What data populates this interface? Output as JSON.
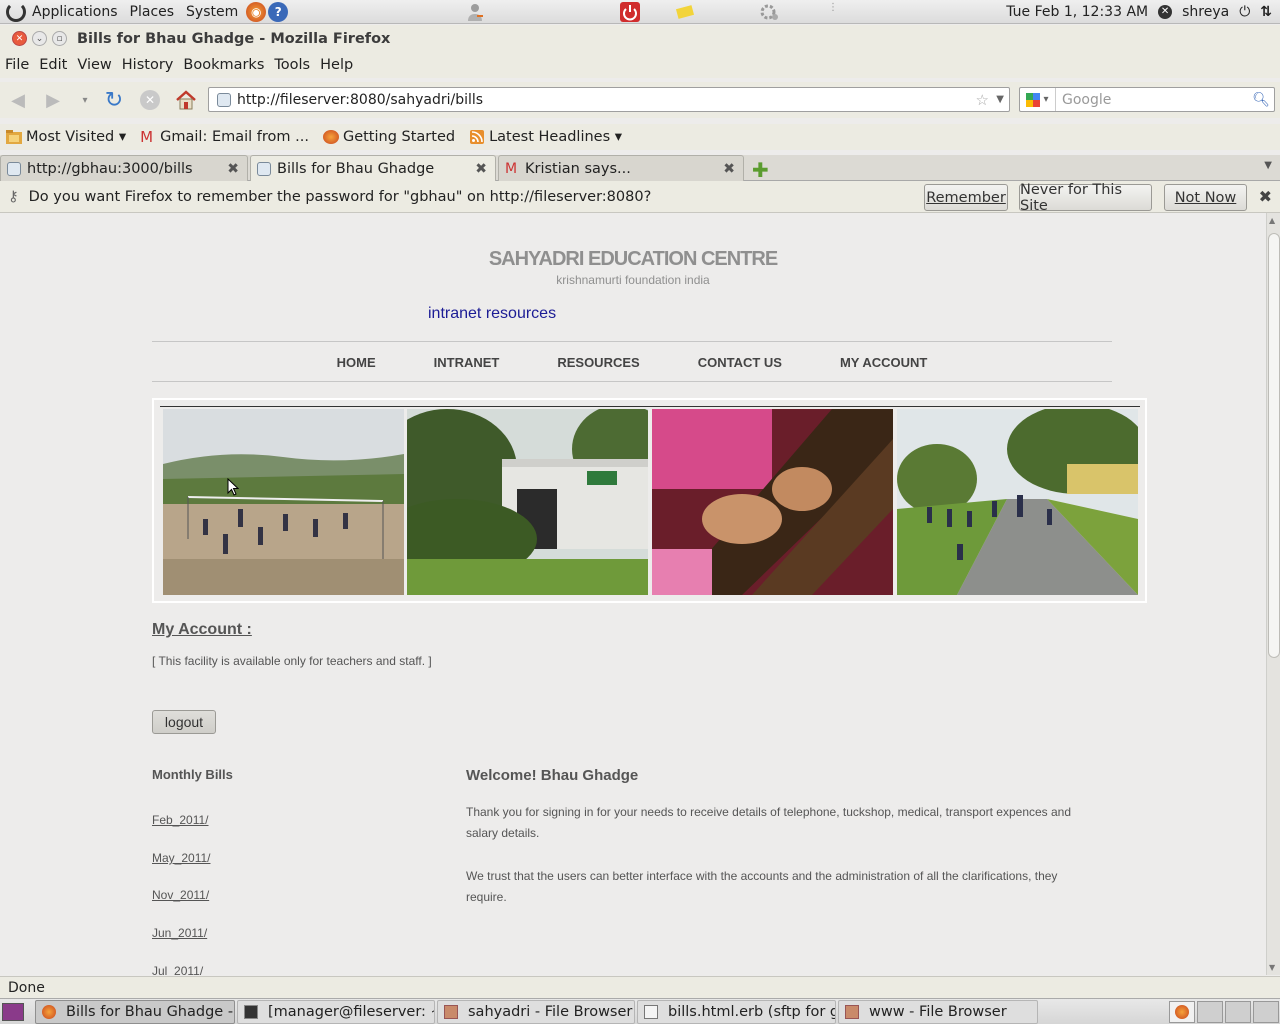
{
  "panel": {
    "menus": [
      "Applications",
      "Places",
      "System"
    ],
    "datetime": "Tue Feb  1, 12:33 AM",
    "user": "shreya"
  },
  "window": {
    "title": "Bills for Bhau Ghadge - Mozilla Firefox"
  },
  "menubar": [
    "File",
    "Edit",
    "View",
    "History",
    "Bookmarks",
    "Tools",
    "Help"
  ],
  "navigation": {
    "url": "http://fileserver:8080/sahyadri/bills",
    "search_placeholder": "Google"
  },
  "bookmarks": [
    "Most Visited ▾",
    "Gmail: Email from ...",
    "Getting Started",
    "Latest Headlines ▾"
  ],
  "tabs": [
    {
      "label": "http://gbhau:3000/bills"
    },
    {
      "label": "Bills for Bhau Ghadge"
    },
    {
      "label": "Kristian says..."
    }
  ],
  "password_bar": {
    "message": "Do you want Firefox to remember the password for \"gbhau\" on http://fileserver:8080?",
    "remember": "Remember",
    "never": "Never for This Site",
    "not_now": "Not Now"
  },
  "page": {
    "site_title": "SAHYADRI EDUCATION CENTRE",
    "site_subtitle": "krishnamurti foundation india",
    "intranet_link": "intranet resources",
    "nav": [
      "HOME",
      "INTRANET",
      "RESOURCES",
      "CONTACT US",
      "MY ACCOUNT"
    ],
    "my_account_heading": "My Account :",
    "note": "[ This facility is available only for teachers and staff. ]",
    "logout": "logout",
    "bills_heading": "Monthly Bills",
    "bills": [
      "Feb_2011/",
      "May_2011/",
      "Nov_2011/",
      "Jun_2011/",
      "Jul_2011/"
    ],
    "welcome": "Welcome! Bhau Ghadge",
    "para1": "Thank you for signing in for your needs to receive details of telephone, tuckshop, medical, transport expences and salary details.",
    "para2": "We trust that the users can better interface with the accounts and the administration of all the clarifications, they require."
  },
  "status": "Done",
  "taskbar": [
    "Bills for Bhau Ghadge - ...",
    "[manager@fileserver: ~]",
    "sahyadri - File Browser",
    "bills.html.erb (sftp for g...",
    "www - File Browser"
  ],
  "colors": {
    "link_blue": "#1c1c95",
    "text_grey": "#555555",
    "brand_grey": "#8f8f8f"
  }
}
